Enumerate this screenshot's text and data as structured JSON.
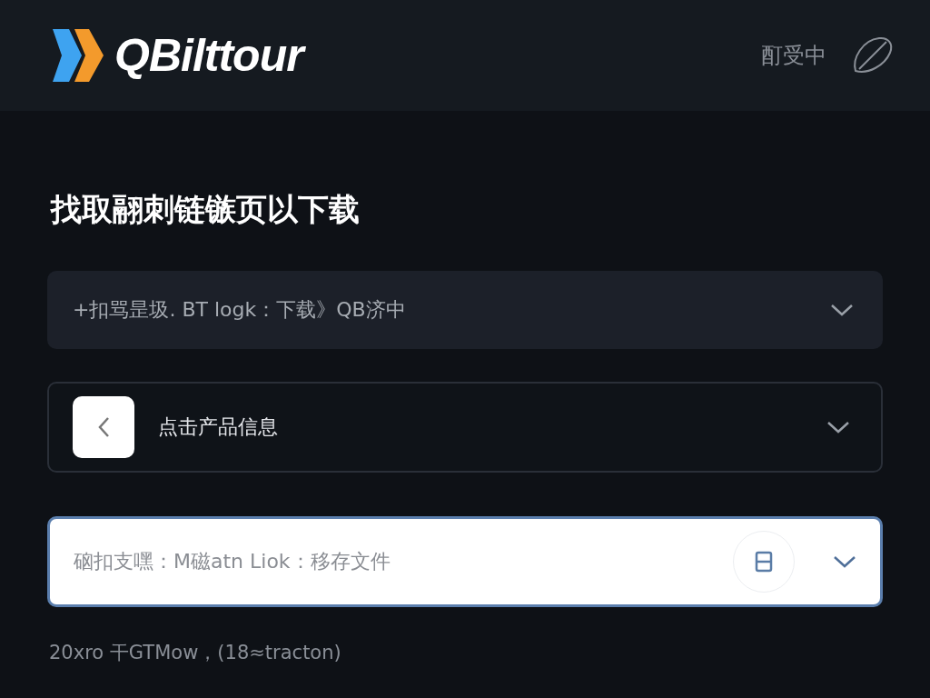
{
  "header": {
    "brand": "QBilttour",
    "status": "酊受中"
  },
  "title": "找取翮刺链镞页以下载",
  "fields": [
    {
      "kind": "filled",
      "value": "+扣骂昰圾. BT logk：下载》QB济中"
    },
    {
      "kind": "back",
      "value": "点击产品信息"
    },
    {
      "kind": "focused",
      "value": "硇扣支嘿：M磁atn Liok：移存文件"
    }
  ],
  "footer": "20xro 干GTMow，(18≈tracton)"
}
